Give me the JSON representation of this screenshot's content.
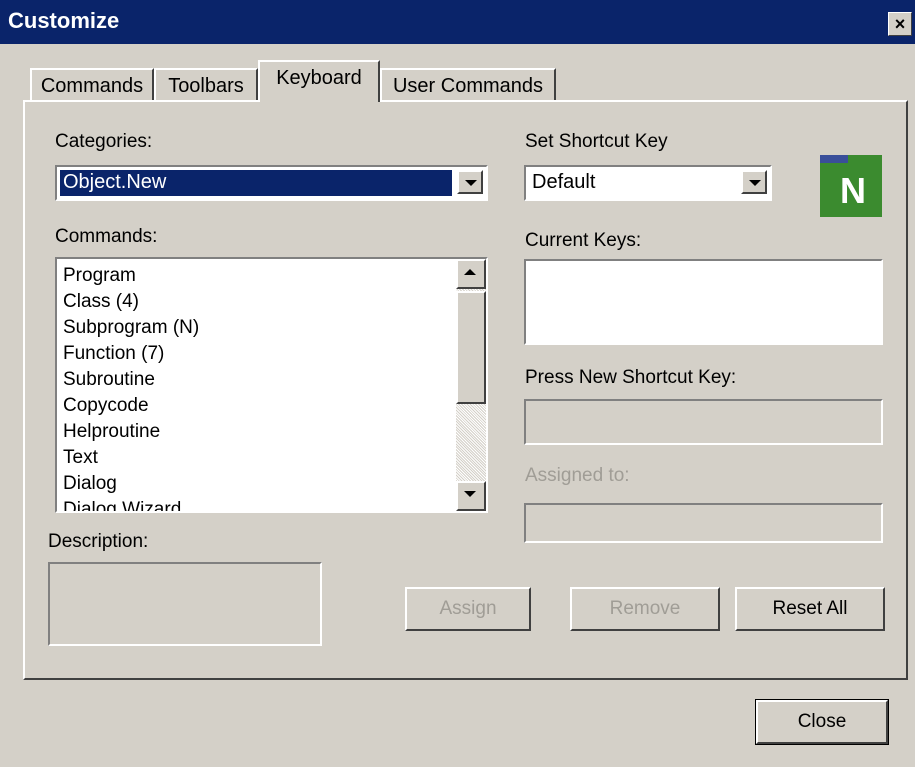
{
  "window": {
    "title": "Customize",
    "close_glyph": "×"
  },
  "tabs": [
    {
      "label": "Commands",
      "active": false
    },
    {
      "label": "Toolbars",
      "active": false
    },
    {
      "label": "Keyboard",
      "active": true
    },
    {
      "label": "User Commands",
      "active": false
    }
  ],
  "categories": {
    "label": "Categories:",
    "value": "Object.New"
  },
  "commands": {
    "label": "Commands:",
    "items": [
      "Program",
      "Class (4)",
      "Subprogram (N)",
      "Function (7)",
      "Subroutine",
      "Copycode",
      "Helproutine",
      "Text",
      "Dialog",
      "Dialog Wizard"
    ]
  },
  "description": {
    "label": "Description:",
    "value": ""
  },
  "shortcut": {
    "label": "Set Shortcut Key",
    "value": "Default"
  },
  "current_keys": {
    "label": "Current Keys:"
  },
  "new_shortcut": {
    "label": "Press New Shortcut Key:",
    "value": ""
  },
  "assigned_to": {
    "label": "Assigned to:",
    "value": ""
  },
  "buttons": {
    "assign": "Assign",
    "remove": "Remove",
    "reset_all": "Reset All",
    "close": "Close"
  },
  "logo": {
    "letter": "N",
    "icon": "natural-logo-icon"
  }
}
